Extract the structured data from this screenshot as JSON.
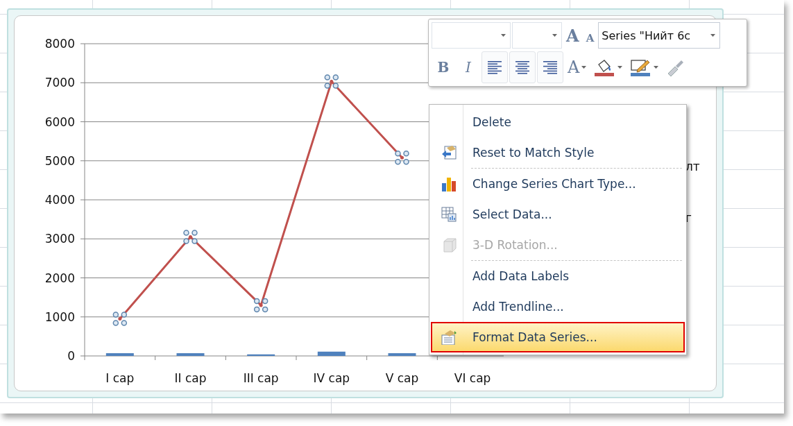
{
  "chart": {
    "chart_data": {
      "type": "line",
      "categories": [
        "I cap",
        "II cap",
        "III cap",
        "IV cap",
        "V cap",
        "VI cap"
      ],
      "ylim": [
        0,
        8000
      ],
      "grid": true,
      "yticks": [
        0,
        1000,
        2000,
        3000,
        4000,
        5000,
        6000,
        7000,
        8000
      ],
      "series": [
        {
          "type": "bar",
          "color": "#4f81bd",
          "values": [
            70,
            70,
            40,
            110,
            70,
            null
          ]
        },
        {
          "type": "line",
          "color": "#c0504d",
          "values": [
            950,
            3050,
            1300,
            7030,
            5080,
            null
          ]
        }
      ]
    },
    "legend_fragments": [
      "лт",
      "г"
    ]
  },
  "toolbar": {
    "grow_font": "A",
    "shrink_font": "A",
    "series_field": {
      "value": "Series \"Нийт 6с"
    },
    "bold": "B",
    "italic": "I",
    "font_color": "A",
    "align": [
      {
        "selected": false
      },
      {
        "selected": false
      },
      {
        "selected": false
      }
    ]
  },
  "context_menu": {
    "groups": [
      [
        {
          "label": "Delete",
          "disabled": false,
          "selected": false
        },
        {
          "label": "Reset to Match Style",
          "disabled": false,
          "selected": false
        }
      ],
      [
        {
          "label": "Change Series Chart Type...",
          "disabled": false,
          "selected": false
        },
        {
          "label": "Select Data...",
          "disabled": false,
          "selected": false
        },
        {
          "label": "3-D Rotation...",
          "disabled": true,
          "selected": false
        }
      ],
      [
        {
          "label": "Add Data Labels",
          "disabled": false,
          "selected": false
        },
        {
          "label": "Add Trendline...",
          "disabled": false,
          "selected": false
        },
        {
          "label": "Format Data Series...",
          "disabled": false,
          "selected": true
        }
      ]
    ]
  }
}
